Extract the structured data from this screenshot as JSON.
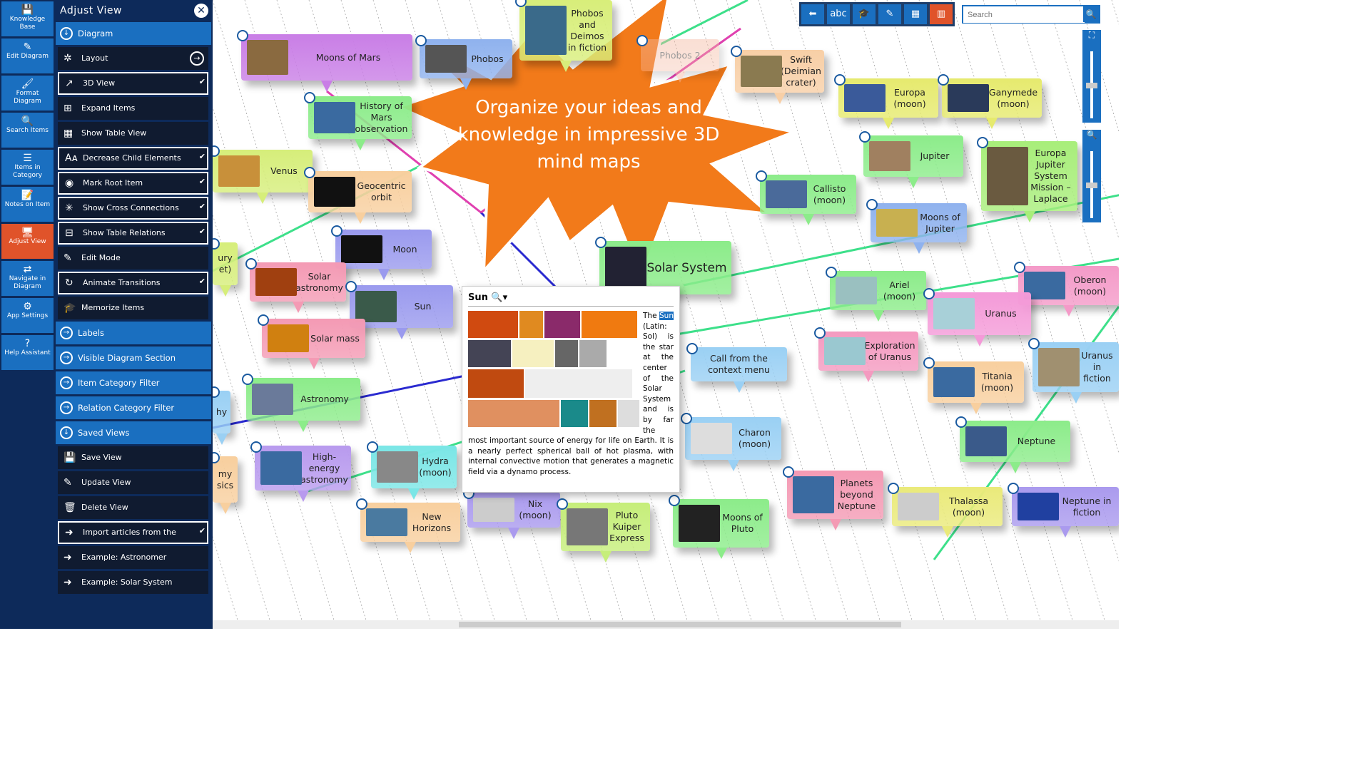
{
  "rail": [
    {
      "label": "Knowledge Base",
      "icon": "save-icon"
    },
    {
      "label": "Edit Diagram",
      "icon": "pencil-icon"
    },
    {
      "label": "Format Diagram",
      "icon": "paint-icon"
    },
    {
      "label": "Search Items",
      "icon": "search-icon"
    },
    {
      "label": "Items in Category",
      "icon": "category-icon"
    },
    {
      "label": "Notes on Item",
      "icon": "notes-icon"
    },
    {
      "label": "Adjust View",
      "icon": "monitor-icon",
      "active": true
    },
    {
      "label": "Navigate in Diagram",
      "icon": "arrows-icon"
    },
    {
      "label": "App Settings",
      "icon": "gear-icon"
    },
    {
      "label": "Help Assistant",
      "icon": "help-icon"
    }
  ],
  "panel": {
    "title": "Adjust View",
    "sections": [
      {
        "label": "Diagram",
        "items": [
          {
            "label": "Layout",
            "icon": "layout-icon"
          },
          {
            "label": "3D View",
            "icon": "3d-icon",
            "checked": true
          },
          {
            "label": "Expand Items",
            "icon": "plus-icon"
          },
          {
            "label": "Show Table View",
            "icon": "table-icon"
          },
          {
            "label": "Decrease Child Elements",
            "icon": "font-size-icon",
            "checked": true
          },
          {
            "label": "Mark Root Item",
            "icon": "target-icon",
            "checked": true
          },
          {
            "label": "Show Cross Connections",
            "icon": "network-icon",
            "checked": true
          },
          {
            "label": "Show Table Relations",
            "icon": "table-relations-icon",
            "checked": true
          },
          {
            "label": "Edit Mode",
            "icon": "pencil-icon"
          },
          {
            "label": "Animate Transitions",
            "icon": "refresh-icon",
            "checked": true
          },
          {
            "label": "Memorize Items",
            "icon": "cap-icon"
          }
        ]
      },
      {
        "label": "Labels",
        "items": []
      },
      {
        "label": "Visible Diagram Section",
        "items": []
      },
      {
        "label": "Item Category Filter",
        "items": []
      },
      {
        "label": "Relation Category Filter",
        "items": []
      },
      {
        "label": "Saved Views",
        "items": [
          {
            "label": "Save View",
            "icon": "save-icon"
          },
          {
            "label": "Update View",
            "icon": "pencil-icon"
          },
          {
            "label": "Delete View",
            "icon": "trash-icon"
          },
          {
            "label": "Import articles from the Wikipedia",
            "icon": "import-icon",
            "checked": true
          },
          {
            "label": "Example: Astronomer",
            "icon": "arrow-icon"
          },
          {
            "label": "Example: Solar System",
            "icon": "arrow-icon"
          }
        ]
      }
    ]
  },
  "toolbar": [
    {
      "icon": "back-icon",
      "glyph": "⬅"
    },
    {
      "icon": "abc-icon",
      "glyph": "abc"
    },
    {
      "icon": "graduation-cap-icon",
      "glyph": "🎓"
    },
    {
      "icon": "pencil-icon",
      "glyph": "✎"
    },
    {
      "icon": "table-icon",
      "glyph": "▦"
    },
    {
      "icon": "panel-icon",
      "glyph": "▥",
      "active": true
    }
  ],
  "search": {
    "placeholder": "Search"
  },
  "promo": "Organize your ideas and knowledge in impressive 3D mind maps",
  "nodes": [
    {
      "label": "Moons of Mars",
      "color": "#c97ee6",
      "thumb": "#8a6a40"
    },
    {
      "label": "Phobos",
      "color": "#8fb2ee",
      "thumb": "#555"
    },
    {
      "label": "Phobos and Deimos in fiction",
      "color": "#d8ee7a",
      "thumb": "#3a6a8a"
    },
    {
      "label": "Phobos 2",
      "color": "#f4b8a0",
      "faded": true
    },
    {
      "label": "Swift (Deimian crater)",
      "color": "#f8cfa6",
      "thumb": "#8a7a50"
    },
    {
      "label": "Europa (moon)",
      "color": "#e6ea6e",
      "thumb": "#3a5a9a"
    },
    {
      "label": "Ganymede (moon)",
      "color": "#e6ea6e",
      "thumb": "#2a3a5a"
    },
    {
      "label": "History of Mars observation",
      "color": "#8cec8a",
      "thumb": "#3a6aa0"
    },
    {
      "label": "Venus",
      "color": "#d6ee7a",
      "thumb": "#c8903a"
    },
    {
      "label": "Geocentric orbit",
      "color": "#f8cf9e",
      "thumb": "#111"
    },
    {
      "label": "Jupiter",
      "color": "#8cec8a",
      "thumb": "#a08060"
    },
    {
      "label": "Europa Jupiter System Mission – Laplace",
      "color": "#a8ee7a",
      "thumb": "#6a5a40"
    },
    {
      "label": "Callisto (moon)",
      "color": "#8cec8a",
      "thumb": "#4a6a9a"
    },
    {
      "label": "Moons of Jupiter",
      "color": "#8fb2ee",
      "thumb": "#c8b050"
    },
    {
      "label": "Moon",
      "color": "#9a9aee",
      "thumb": "#111"
    },
    {
      "label": "Solar System",
      "color": "#8cec8a",
      "thumb": "#223"
    },
    {
      "label": "Solar astronomy",
      "color": "#f49ab4",
      "thumb": "#a04010"
    },
    {
      "label": "Sun",
      "color": "#9a9aee",
      "thumb": "#3a5a4a"
    },
    {
      "label": "Ariel (moon)",
      "color": "#8cec8a",
      "thumb": "#9ac0c0"
    },
    {
      "label": "Oberon (moon)",
      "color": "#f49ac8",
      "thumb": "#3a6aa0"
    },
    {
      "label": "Uranus",
      "color": "#f49ad8",
      "thumb": "#a8d0d8"
    },
    {
      "label": "Solar mass",
      "color": "#f49ab4",
      "thumb": "#d08010"
    },
    {
      "label": "Call from the context menu",
      "color": "#9ad0f4",
      "thumb": ""
    },
    {
      "label": "Exploration of Uranus",
      "color": "#f49ac0",
      "thumb": "#9ac8d0"
    },
    {
      "label": "Titania (moon)",
      "color": "#f8cf9e",
      "thumb": "#3a6aa0"
    },
    {
      "label": "Uranus in fiction",
      "color": "#9ad0f4",
      "thumb": "#a09070"
    },
    {
      "label": "Astronomy",
      "color": "#8cec8a",
      "thumb": "#6a7a9a"
    },
    {
      "label": "Charon (moon)",
      "color": "#9ad0f4",
      "thumb": "#ddd"
    },
    {
      "label": "Neptune",
      "color": "#8cec8a",
      "thumb": "#3a5a8a"
    },
    {
      "label": "High-energy astronomy",
      "color": "#b89aee",
      "thumb": "#3a6aa0"
    },
    {
      "label": "Hydra (moon)",
      "color": "#7ae6e6",
      "thumb": "#888"
    },
    {
      "label": "Planets beyond Neptune",
      "color": "#f49ab4",
      "thumb": "#3a6aa0"
    },
    {
      "label": "Thalassa (moon)",
      "color": "#eaea7a",
      "thumb": "#ccc"
    },
    {
      "label": "Neptune in fiction",
      "color": "#aa9aee",
      "thumb": "#2040a0"
    },
    {
      "label": "New Horizons",
      "color": "#f8cf9e",
      "thumb": "#4a7aa0"
    },
    {
      "label": "Nix (moon)",
      "color": "#aa9aee",
      "thumb": "#ccc"
    },
    {
      "label": "Pluto Kuiper Express",
      "color": "#c6ee7a",
      "thumb": "#777"
    },
    {
      "label": "Moons of Pluto",
      "color": "#8cec8a",
      "thumb": "#222"
    },
    {
      "label": "ury et)",
      "color": "#d6ee7a",
      "thumb": ""
    },
    {
      "label": "hy",
      "color": "#9ad0f4",
      "thumb": ""
    },
    {
      "label": "my sics",
      "color": "#f8cf9e",
      "thumb": ""
    }
  ],
  "popup": {
    "title": "Sun",
    "text_pre": "The ",
    "highlight": "Sun",
    "text_post": " (Latin: Sol) is the star at the center of the Solar System and is by far the most important source of energy for life on Earth. It is a nearly perfect spherical ball of hot plasma, with internal convective motion that generates a magnetic field via a dynamo process."
  }
}
